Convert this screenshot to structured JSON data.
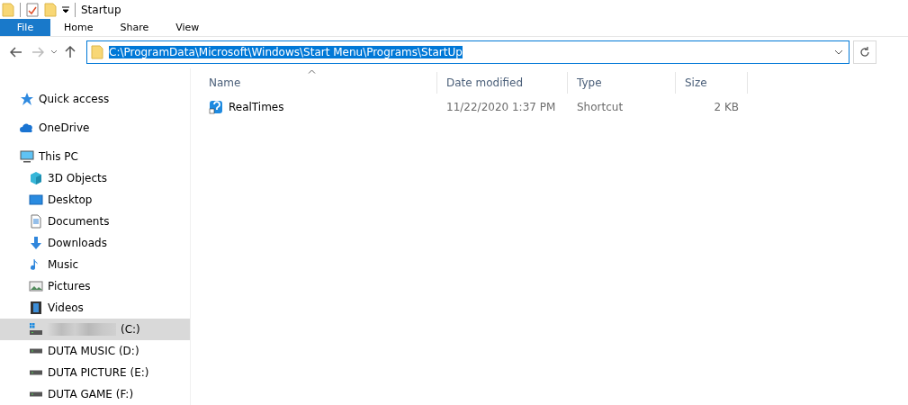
{
  "window": {
    "title": "Startup"
  },
  "ribbon_tabs": [
    {
      "label": "File",
      "selected": true
    },
    {
      "label": "Home",
      "selected": false
    },
    {
      "label": "Share",
      "selected": false
    },
    {
      "label": "View",
      "selected": false
    }
  ],
  "address_bar": {
    "value": "C:\\ProgramData\\Microsoft\\Windows\\Start Menu\\Programs\\StartUp",
    "text_selected": true
  },
  "nav_pane": {
    "items": [
      {
        "label": "Quick access",
        "kind": "star",
        "selected": false
      },
      {
        "label": "OneDrive",
        "kind": "cloud",
        "selected": false
      },
      {
        "label": "This PC",
        "kind": "pc",
        "selected": false,
        "children": [
          {
            "label": "3D Objects",
            "kind": "cube",
            "selected": false
          },
          {
            "label": "Desktop",
            "kind": "desktop",
            "selected": false
          },
          {
            "label": "Documents",
            "kind": "document",
            "selected": false
          },
          {
            "label": "Downloads",
            "kind": "download",
            "selected": false
          },
          {
            "label": "Music",
            "kind": "music",
            "selected": false
          },
          {
            "label": "Pictures",
            "kind": "pictures",
            "selected": false
          },
          {
            "label": "Videos",
            "kind": "videos",
            "selected": false
          },
          {
            "label": "(C:)",
            "kind": "system-drive",
            "redacted": true,
            "selected": true
          },
          {
            "label": "DUTA MUSIC (D:)",
            "kind": "drive",
            "selected": false
          },
          {
            "label": "DUTA PICTURE (E:)",
            "kind": "drive",
            "selected": false
          },
          {
            "label": "DUTA GAME (F:)",
            "kind": "drive",
            "selected": false
          }
        ]
      }
    ]
  },
  "file_list": {
    "columns": [
      "Name",
      "Date modified",
      "Type",
      "Size"
    ],
    "rows": [
      {
        "name": "RealTimes",
        "date_modified": "11/22/2020 1:37 PM",
        "type": "Shortcut",
        "size": "2 KB"
      }
    ]
  }
}
